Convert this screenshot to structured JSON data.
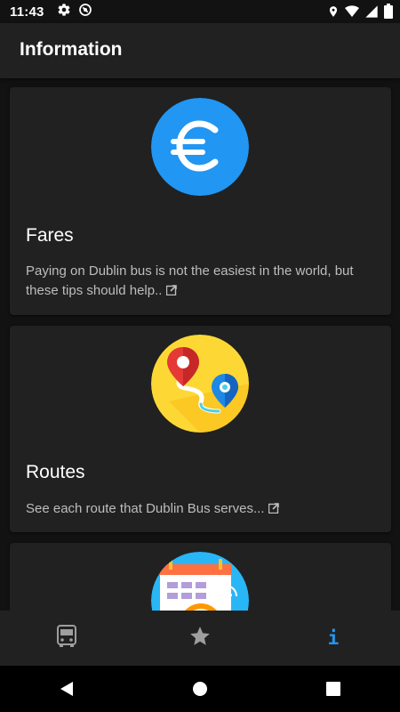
{
  "status_bar": {
    "time": "11:43",
    "icons": [
      "settings-icon",
      "sync-icon",
      "location-icon",
      "wifi-icon",
      "signal-icon",
      "battery-icon"
    ]
  },
  "app_bar": {
    "title": "Information"
  },
  "cards": [
    {
      "title": "Fares",
      "description": "Paying on Dublin bus is not the easiest in the world, but these tips should help..",
      "icon": "euro-icon",
      "icon_color": "#2196f3"
    },
    {
      "title": "Routes",
      "description": "See each route that Dublin Bus serves...",
      "icon": "map-route-icon",
      "icon_color": "#fdd835"
    },
    {
      "title": "",
      "description": "",
      "icon": "calendar-clock-icon",
      "icon_color": "#29b6f6"
    }
  ],
  "bottom_nav": {
    "items": [
      {
        "icon": "bus-icon",
        "active": false
      },
      {
        "icon": "star-icon",
        "active": false
      },
      {
        "icon": "info-icon",
        "active": true
      }
    ],
    "active_color": "#2196f3",
    "inactive_color": "#9e9e9e"
  },
  "system_nav": {
    "icons": [
      "back-icon",
      "home-icon",
      "recents-icon"
    ]
  },
  "colors": {
    "background": "#121212",
    "surface": "#212121",
    "accent": "#2196f3"
  }
}
